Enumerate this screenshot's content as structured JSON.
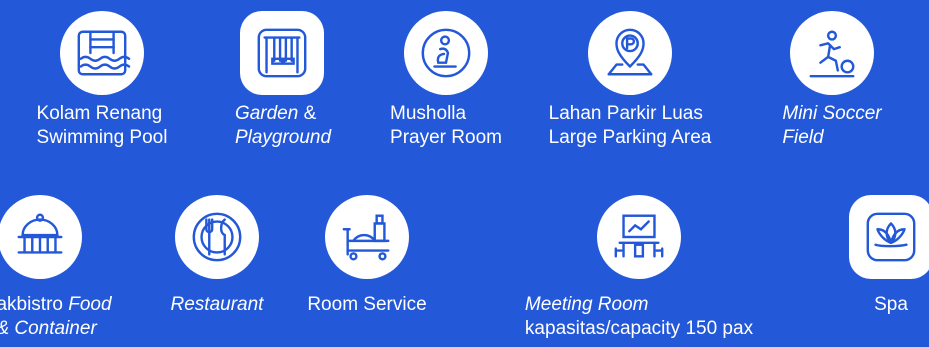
{
  "colors": {
    "background": "#2358d8",
    "icon_bg": "#ffffff",
    "icon_stroke": "#2358d8",
    "text": "#ffffff"
  },
  "facilities": [
    {
      "icon": "swimming-pool-icon",
      "line1": "Kolam Renang",
      "line2": "Swimming Pool"
    },
    {
      "icon": "swing-playground-icon",
      "line1_italic": "Garden",
      "line1_rest": " &",
      "line2": "Playground"
    },
    {
      "icon": "prayer-person-icon",
      "line1": "Musholla",
      "line2": "Prayer Room"
    },
    {
      "icon": "parking-pin-icon",
      "line1": "Lahan Parkir Luas",
      "line2": "Large Parking Area"
    },
    {
      "icon": "soccer-player-icon",
      "line1": "Mini Soccer",
      "line2": "Field"
    },
    {
      "icon": "food-cloche-icon",
      "line1_rest": "akbistro ",
      "line1_italic": "Food",
      "line2": "& Container"
    },
    {
      "icon": "plate-utensils-icon",
      "line1": "Restaurant"
    },
    {
      "icon": "room-service-cart-icon",
      "line1": "Room Service"
    },
    {
      "icon": "meeting-presentation-icon",
      "line1": "Meeting Room",
      "line2": "kapasitas/capacity 150 pax"
    },
    {
      "icon": "lotus-icon",
      "line1": "Spa"
    }
  ]
}
